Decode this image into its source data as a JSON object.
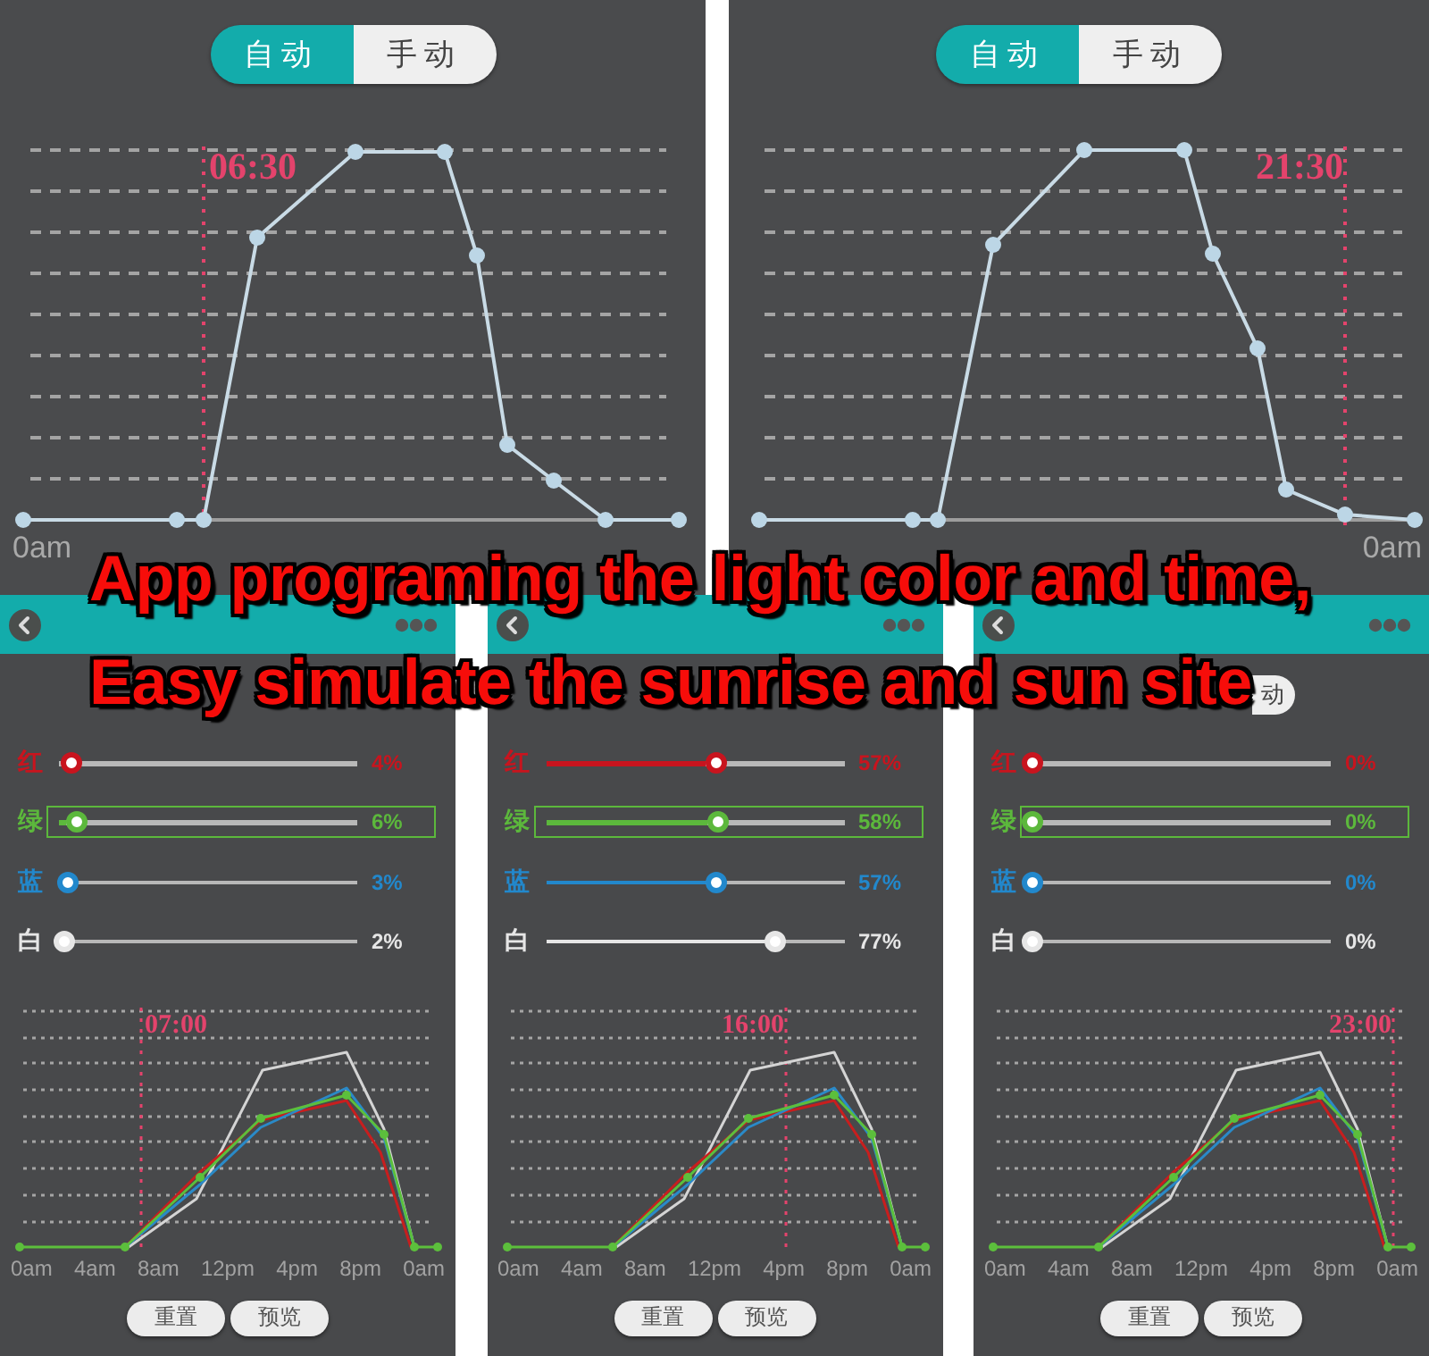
{
  "top_panels": [
    {
      "mode_toggle": [
        {
          "label": "自动",
          "selected": true
        },
        {
          "label": "手动",
          "selected": false
        }
      ],
      "time_label": "06:30",
      "axis_start_label": "0am"
    },
    {
      "mode_toggle": [
        {
          "label": "自动",
          "selected": true
        },
        {
          "label": "手动",
          "selected": false
        }
      ],
      "time_label": "21:30",
      "axis_end_label": "0am"
    }
  ],
  "bottom_panels": [
    {
      "channels": [
        {
          "label": "红",
          "value": "4%",
          "level": 0.04,
          "selected": false,
          "color": "#c8141e"
        },
        {
          "label": "绿",
          "value": "6%",
          "level": 0.06,
          "selected": true,
          "color": "#5cb83c"
        },
        {
          "label": "蓝",
          "value": "3%",
          "level": 0.03,
          "selected": false,
          "color": "#2288cc"
        },
        {
          "label": "白",
          "value": "2%",
          "level": 0.02,
          "selected": false,
          "color": "#e6e6e6"
        }
      ],
      "time_label": "07:00",
      "x_labels": [
        "0am",
        "4am",
        "8am",
        "12pm",
        "4pm",
        "8pm",
        "0am"
      ],
      "buttons": [
        "重置",
        "预览"
      ]
    },
    {
      "channels": [
        {
          "label": "红",
          "value": "57%",
          "level": 0.57,
          "selected": false,
          "color": "#c8141e"
        },
        {
          "label": "绿",
          "value": "58%",
          "level": 0.58,
          "selected": true,
          "color": "#5cb83c"
        },
        {
          "label": "蓝",
          "value": "57%",
          "level": 0.57,
          "selected": false,
          "color": "#2288cc"
        },
        {
          "label": "白",
          "value": "77%",
          "level": 0.77,
          "selected": false,
          "color": "#e6e6e6"
        }
      ],
      "time_label": "16:00",
      "x_labels": [
        "0am",
        "4am",
        "8am",
        "12pm",
        "4pm",
        "8pm",
        "0am"
      ],
      "buttons": [
        "重置",
        "预览"
      ]
    },
    {
      "mode_toggle_label": "动",
      "channels": [
        {
          "label": "红",
          "value": "0%",
          "level": 0,
          "selected": false,
          "color": "#c8141e"
        },
        {
          "label": "绿",
          "value": "0%",
          "level": 0,
          "selected": true,
          "color": "#5cb83c"
        },
        {
          "label": "蓝",
          "value": "0%",
          "level": 0,
          "selected": false,
          "color": "#2288cc"
        },
        {
          "label": "白",
          "value": "0%",
          "level": 0,
          "selected": false,
          "color": "#e6e6e6"
        }
      ],
      "time_label": "23:00",
      "x_labels": [
        "0am",
        "4am",
        "8am",
        "12pm",
        "4pm",
        "8pm",
        "0am"
      ],
      "buttons": [
        "重置",
        "预览"
      ]
    }
  ],
  "caption": [
    "App programing the light color and time,",
    "Easy simulate the sunrise and sun site"
  ]
}
